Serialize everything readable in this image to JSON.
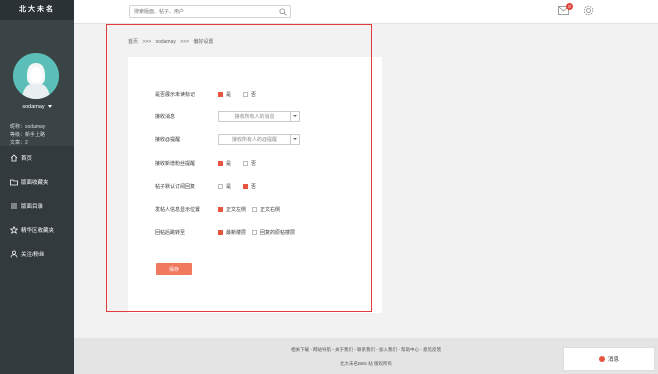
{
  "brand": "北大未名",
  "user": {
    "name": "sodamay",
    "nickname_label": "昵称：",
    "nickname": "sodamay",
    "level_label": "等级：",
    "level": "新手上路",
    "posts_label": "文章：",
    "posts": "2"
  },
  "nav": [
    {
      "label": "首页",
      "icon": "home-icon"
    },
    {
      "label": "版面收藏夹",
      "icon": "folder-icon"
    },
    {
      "label": "版面目录",
      "icon": "list-icon"
    },
    {
      "label": "精华区收藏夹",
      "icon": "star-icon"
    },
    {
      "label": "关注/粉丝",
      "icon": "user-icon"
    }
  ],
  "search": {
    "placeholder": "搜索版面、帖子、用户"
  },
  "notifications": {
    "badge": "0"
  },
  "breadcrumb": [
    "首页",
    ">>>",
    "sodamay",
    ">>>",
    "偏好设置"
  ],
  "settings": {
    "rows": [
      {
        "label": "是否展示未读标记",
        "type": "radio",
        "options": [
          "是",
          "否"
        ],
        "selected": 0
      },
      {
        "label": "接收消息",
        "type": "select",
        "value": "接收所有人的消息"
      },
      {
        "label": "接收@提醒",
        "type": "select",
        "value": "接收所有人的@提醒"
      },
      {
        "label": "接收新增粉丝提醒",
        "type": "radio",
        "options": [
          "是",
          "否"
        ],
        "selected": 0
      },
      {
        "label": "帖子默认订阅回复",
        "type": "radio",
        "options": [
          "是",
          "否"
        ],
        "selected": 1
      },
      {
        "label": "发帖人信息显示位置",
        "type": "radio",
        "options": [
          "正文左侧",
          "正文右侧"
        ],
        "selected": 0
      },
      {
        "label": "回帖后跳转至",
        "type": "radio",
        "options": [
          "最新楼层",
          "回复的原帖楼层"
        ],
        "selected": 0
      }
    ],
    "save_label": "保存"
  },
  "footer": {
    "links": "相关下载 - 网站导航 - 关于我们 - 联系我们 - 加入我们 - 帮助中心 - 意见反馈",
    "copyright": "北大未名BBS 站 版权所有"
  },
  "message_button": "消息",
  "colors": {
    "accent": "#e8553f",
    "sidebar": "#323a3d",
    "highlight_border": "#e33b3b"
  }
}
